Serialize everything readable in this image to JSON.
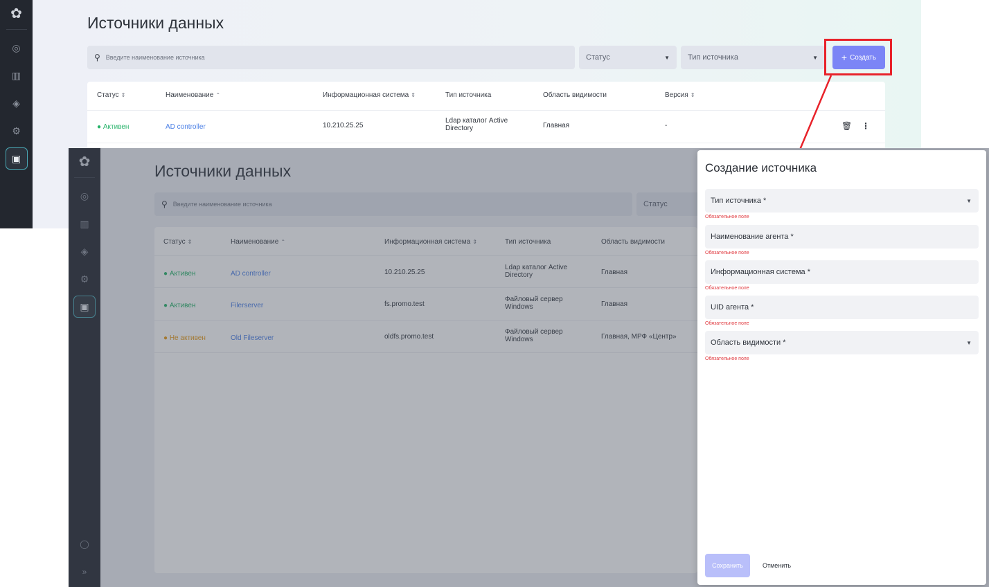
{
  "page": {
    "title": "Источники данных",
    "search_placeholder": "Введите наименование источника",
    "status_filter": "Статус",
    "type_filter": "Тип источника",
    "create_label": "Создать"
  },
  "sidebar": {
    "icons": [
      "logo-icon",
      "eye-icon",
      "chart-icon",
      "layers-icon",
      "gear-icon",
      "monitor-icon"
    ],
    "bottom_icons": [
      "user-icon",
      "expand-icon"
    ],
    "expand_glyph": "»"
  },
  "table": {
    "columns": [
      "Статус",
      "Наименование",
      "Информационная система",
      "Тип источника",
      "Область видимости",
      "Версия"
    ],
    "rows": [
      {
        "status": "Активен",
        "status_kind": "active",
        "name": "AD controller",
        "system": "10.210.25.25",
        "type_line1": "Ldap каталог Active",
        "type_line2": "Directory",
        "scope": "Главная",
        "version": "-"
      },
      {
        "status": "Активен",
        "status_kind": "active",
        "name": "Filerserver",
        "system": "fs.promo.test",
        "type_line1": "Файловый сервер",
        "type_line2": "Windows",
        "scope": "Главная",
        "version": ""
      },
      {
        "status": "Не активен",
        "status_kind": "inactive",
        "name": "Old Fileserver",
        "system": "oldfs.promo.test",
        "type_line1": "Файловый сервер",
        "type_line2": "Windows",
        "scope": "Главная, МРФ «Центр»",
        "version": ""
      }
    ]
  },
  "dialog": {
    "title": "Создание источника",
    "fields": [
      {
        "label": "Тип источника *",
        "has_dropdown": true
      },
      {
        "label": "Наименование агента *",
        "has_dropdown": false
      },
      {
        "label": "Информационная система *",
        "has_dropdown": false
      },
      {
        "label": "UID агента *",
        "has_dropdown": false
      },
      {
        "label": "Область видимости *",
        "has_dropdown": true
      }
    ],
    "required_error": "Обязательное поле",
    "save_label": "Сохранить",
    "cancel_label": "Отменить"
  },
  "colors": {
    "accent": "#7b85f6",
    "highlight": "#e8222a",
    "active": "#27b36a",
    "inactive": "#e79a17",
    "link": "#4a7fe6",
    "sidebar": "#23272f"
  }
}
